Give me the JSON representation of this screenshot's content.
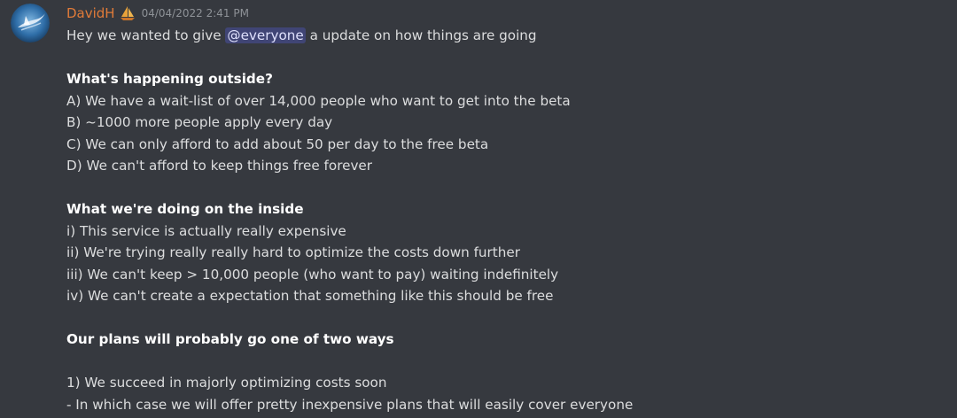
{
  "message": {
    "author": "DavidH",
    "timestamp": "04/04/2022 2:41 PM",
    "colors": {
      "background": "#36393f",
      "username": "#e07b39",
      "mention_bg": "#4a4f8a"
    },
    "avatar_icon": "sailboat-avatar-icon",
    "badge_icon": "sailboat-badge-icon",
    "intro_before": "Hey we wanted to give ",
    "mention": "@everyone",
    "intro_after": " a update on how things are going",
    "section1": {
      "heading": "What's happening outside?",
      "items": [
        "A) We have a wait-list of over 14,000 people who want to get into the beta",
        "B) ~1000 more people apply every day",
        "C) We can only afford to add about 50 per day to the free beta",
        "D) We can't afford to keep things free forever"
      ]
    },
    "section2": {
      "heading": "What we're doing on the inside",
      "items": [
        "i) This service is actually really expensive",
        "ii) We're trying really really hard to optimize the costs down further",
        "iii) We can't keep > 10,000 people (who want to pay) waiting indefinitely",
        "iv) We can't create a expectation that something like this should be free"
      ]
    },
    "section3": {
      "heading": "Our plans will probably go one of two ways",
      "items": [
        "1) We succeed in majorly optimizing costs soon",
        "- In which case we will offer pretty inexpensive plans that will easily cover everyone"
      ]
    }
  }
}
